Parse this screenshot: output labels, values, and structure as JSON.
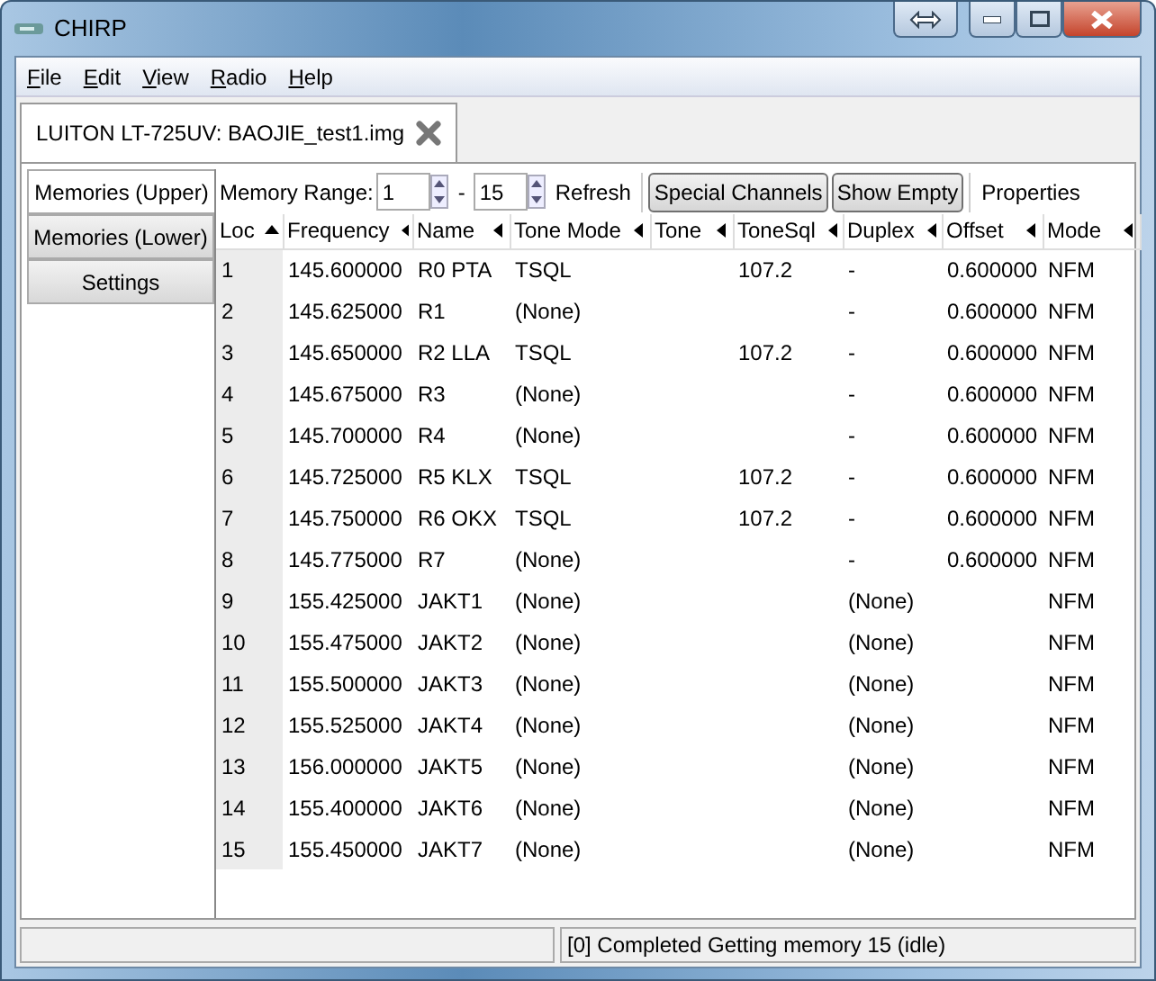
{
  "window": {
    "title": "CHIRP"
  },
  "menu": [
    "File",
    "Edit",
    "View",
    "Radio",
    "Help"
  ],
  "tabs": [
    {
      "label": "LUITON LT-725UV: BAOJIE_test1.img",
      "selected": true
    }
  ],
  "side_tabs": [
    {
      "label": "Memories (Upper)",
      "selected": true
    },
    {
      "label": "Memories (Lower)",
      "selected": false
    },
    {
      "label": "Settings",
      "selected": false
    }
  ],
  "toolbar": {
    "range_label": "Memory Range:",
    "range_start": "1",
    "range_sep": "-",
    "range_end": "15",
    "refresh": "Refresh",
    "special_channels": "Special Channels",
    "show_empty": "Show Empty",
    "properties": "Properties"
  },
  "table": {
    "columns": [
      {
        "label": "Loc",
        "sorted": true
      },
      {
        "label": "Frequency",
        "sorted": false
      },
      {
        "label": "Name",
        "sorted": false
      },
      {
        "label": "Tone Mode",
        "sorted": false
      },
      {
        "label": "Tone",
        "sorted": false
      },
      {
        "label": "ToneSql",
        "sorted": false
      },
      {
        "label": "Duplex",
        "sorted": false
      },
      {
        "label": "Offset",
        "sorted": false
      },
      {
        "label": "Mode",
        "sorted": false
      }
    ],
    "rows": [
      [
        "1",
        "145.600000",
        "R0 PTA",
        "TSQL",
        "",
        "107.2",
        "-",
        "0.600000",
        "NFM"
      ],
      [
        "2",
        "145.625000",
        "R1",
        "(None)",
        "",
        "",
        "-",
        "0.600000",
        "NFM"
      ],
      [
        "3",
        "145.650000",
        "R2 LLA",
        "TSQL",
        "",
        "107.2",
        "-",
        "0.600000",
        "NFM"
      ],
      [
        "4",
        "145.675000",
        "R3",
        "(None)",
        "",
        "",
        "-",
        "0.600000",
        "NFM"
      ],
      [
        "5",
        "145.700000",
        "R4",
        "(None)",
        "",
        "",
        "-",
        "0.600000",
        "NFM"
      ],
      [
        "6",
        "145.725000",
        "R5 KLX",
        "TSQL",
        "",
        "107.2",
        "-",
        "0.600000",
        "NFM"
      ],
      [
        "7",
        "145.750000",
        "R6 OKX",
        "TSQL",
        "",
        "107.2",
        "-",
        "0.600000",
        "NFM"
      ],
      [
        "8",
        "145.775000",
        "R7",
        "(None)",
        "",
        "",
        "-",
        "0.600000",
        "NFM"
      ],
      [
        "9",
        "155.425000",
        "JAKT1",
        "(None)",
        "",
        "",
        "(None)",
        "",
        "NFM"
      ],
      [
        "10",
        "155.475000",
        "JAKT2",
        "(None)",
        "",
        "",
        "(None)",
        "",
        "NFM"
      ],
      [
        "11",
        "155.500000",
        "JAKT3",
        "(None)",
        "",
        "",
        "(None)",
        "",
        "NFM"
      ],
      [
        "12",
        "155.525000",
        "JAKT4",
        "(None)",
        "",
        "",
        "(None)",
        "",
        "NFM"
      ],
      [
        "13",
        "156.000000",
        "JAKT5",
        "(None)",
        "",
        "",
        "(None)",
        "",
        "NFM"
      ],
      [
        "14",
        "155.400000",
        "JAKT6",
        "(None)",
        "",
        "",
        "(None)",
        "",
        "NFM"
      ],
      [
        "15",
        "155.450000",
        "JAKT7",
        "(None)",
        "",
        "",
        "(None)",
        "",
        "NFM"
      ]
    ]
  },
  "status_bar": {
    "message": "[0] Completed Getting memory 15 (idle)"
  }
}
